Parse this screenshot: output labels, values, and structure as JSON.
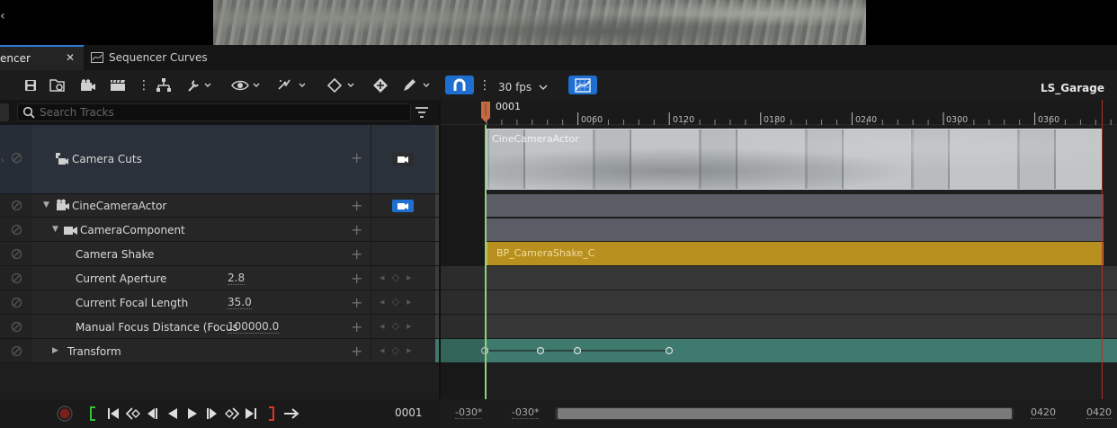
{
  "tabs": {
    "active": {
      "label": "encer"
    },
    "inactive": {
      "label": "Sequencer Curves"
    }
  },
  "toolbar": {
    "fps": "30 fps",
    "sequence_name": "LS_Garage"
  },
  "search": {
    "placeholder": "Search Tracks"
  },
  "ruler": {
    "current_frame": "0001",
    "ticks": [
      "0060",
      "0120",
      "0180",
      "0240",
      "0300",
      "0360"
    ]
  },
  "tracks": [
    {
      "label": "Camera Cuts"
    },
    {
      "label": "CineCameraActor"
    },
    {
      "label": "CameraComponent"
    },
    {
      "label": "Camera Shake"
    },
    {
      "label": "Current Aperture",
      "value": "2.8"
    },
    {
      "label": "Current Focal Length",
      "value": "35.0"
    },
    {
      "label": "Manual Focus Distance (Focus",
      "value": "100000.0"
    },
    {
      "label": "Transform"
    }
  ],
  "sections": {
    "camera_cut_label": "CineCameraActor",
    "shake_label": "BP_CameraShake_C"
  },
  "transport": {
    "frame": "0001"
  },
  "range": {
    "start_left": "-030*",
    "start_right": "-030*",
    "end_left": "0420",
    "end_right": "0420"
  },
  "colors": {
    "accent": "#1f6fd1",
    "shake_section": "#b8901f",
    "transform_lane": "#3f7a6e",
    "playhead": "#8ed07d",
    "end_marker": "#b0302a"
  }
}
